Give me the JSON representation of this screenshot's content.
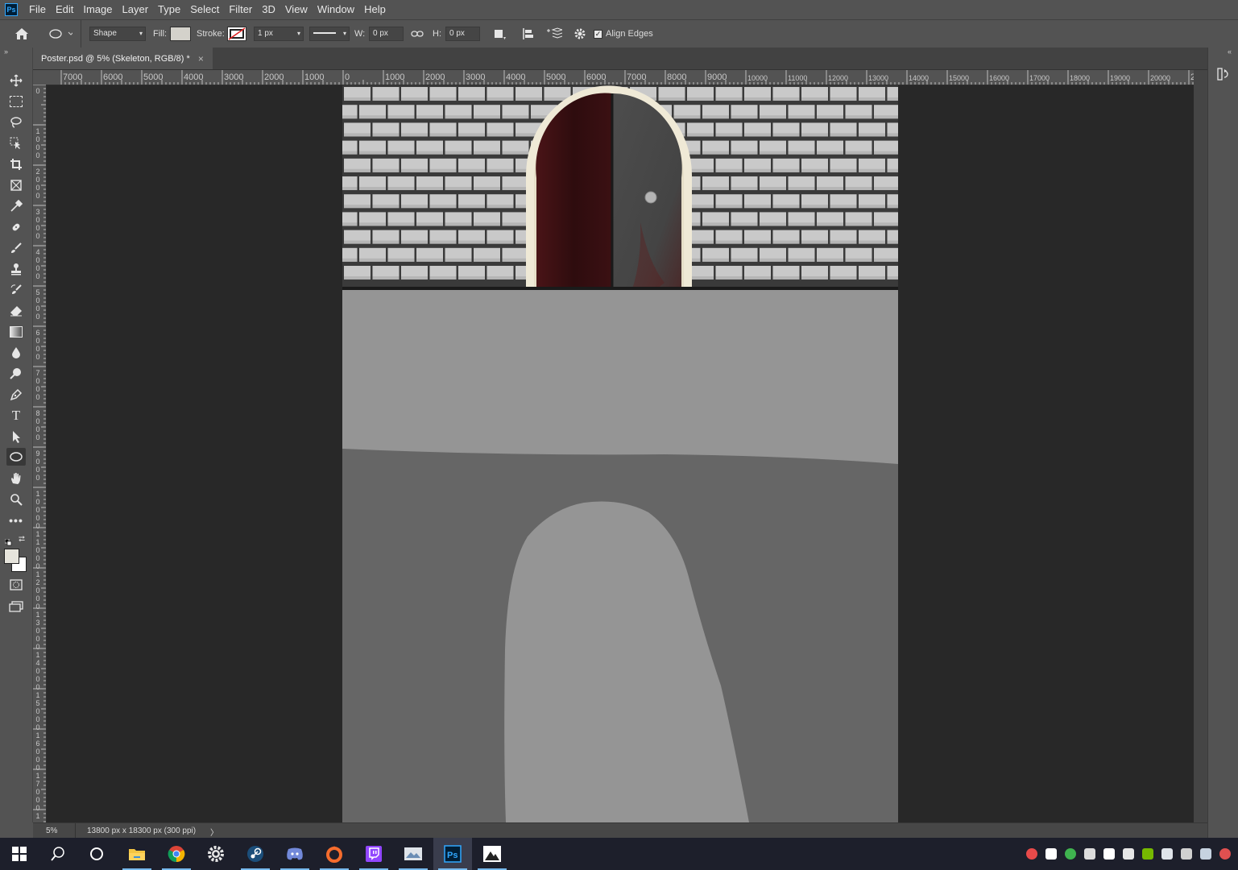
{
  "app": {
    "logo": "Ps"
  },
  "menu": [
    "File",
    "Edit",
    "Image",
    "Layer",
    "Type",
    "Select",
    "Filter",
    "3D",
    "View",
    "Window",
    "Help"
  ],
  "options": {
    "shape_mode": "Shape",
    "fill_label": "Fill:",
    "stroke_label": "Stroke:",
    "stroke_width": "1 px",
    "w_label": "W:",
    "w_value": "0 px",
    "h_label": "H:",
    "h_value": "0 px",
    "align_edges": "Align Edges",
    "align_edges_checked": true,
    "fill_color": "#d4d2cb"
  },
  "document": {
    "tab_title": "Poster.psd @ 5% (Skeleton, RGB/8) *",
    "close_glyph": "×"
  },
  "ruler": {
    "h_labels": [
      "7000",
      "6000",
      "5000",
      "4000",
      "3000",
      "2000",
      "1000",
      "0",
      "1000",
      "2000",
      "3000",
      "4000",
      "5000",
      "6000",
      "7000",
      "8000",
      "9000",
      "10000",
      "11000",
      "12000",
      "13000",
      "14000",
      "15000",
      "16000",
      "17000",
      "18000",
      "19000",
      "20000",
      "2"
    ],
    "v_labels": [
      "0",
      "1000",
      "2000",
      "3000",
      "4000",
      "5000",
      "6000",
      "7000",
      "8000",
      "9000",
      "10000",
      "11000",
      "12000",
      "13000",
      "14000",
      "15000",
      "16000",
      "17000",
      "1"
    ]
  },
  "status": {
    "zoom": "5%",
    "doc_size": "13800 px x 18300 px (300 ppi)",
    "arrow": "〉"
  },
  "colors": {
    "foreground": "#e6e4dc",
    "background": "#ffffff",
    "brick": "#c9c9c9",
    "mortar": "#3a3a3a",
    "door_left": "#3b0f12",
    "door_right": "#4a4a4a",
    "frame": "#efe9d6",
    "floor_light": "#959595",
    "floor_dark": "#666666"
  },
  "taskbar": {
    "apps": [
      "windows-start",
      "search",
      "cortana",
      "file-explorer",
      "chrome",
      "settings",
      "steam",
      "discord",
      "origin",
      "twitch",
      "photos-app",
      "photoshop",
      "image-viewer"
    ],
    "active": "photoshop"
  }
}
